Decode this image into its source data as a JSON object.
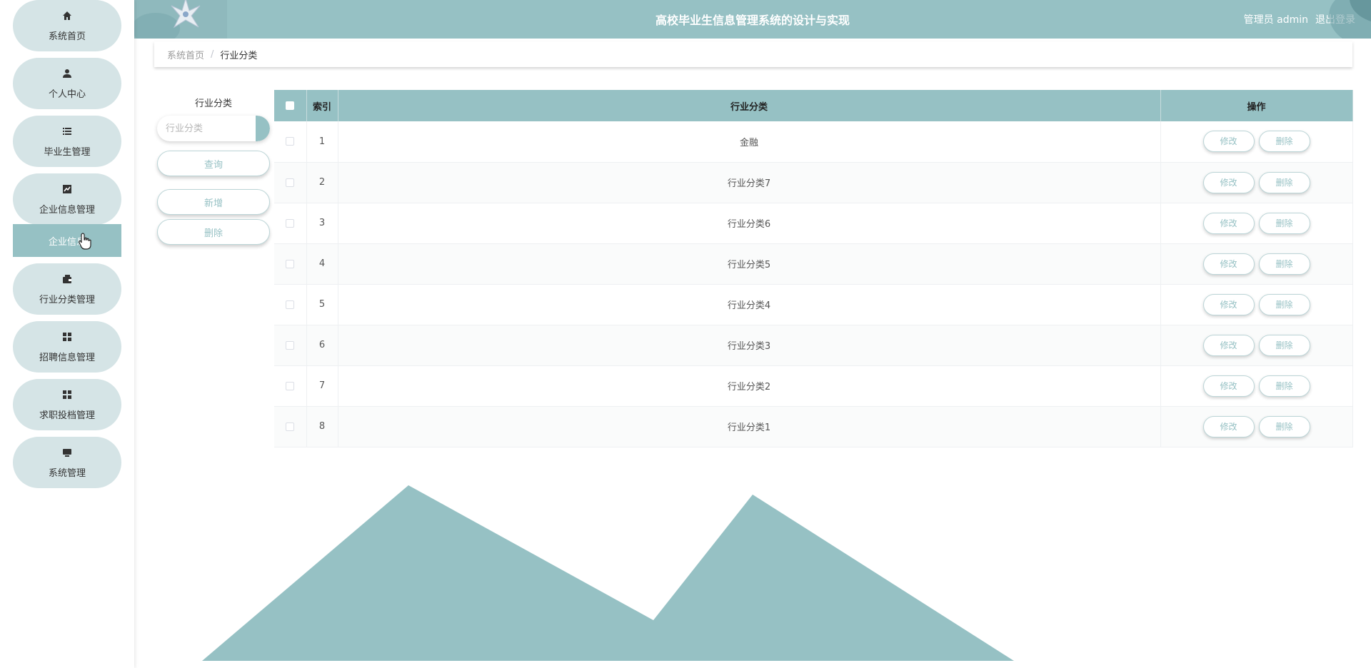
{
  "header": {
    "title": "高校毕业生信息管理系统的设计与实现",
    "user_label": "管理员 admin",
    "logout_label": "退出登录"
  },
  "sidebar": {
    "items": [
      {
        "label": "系统首页",
        "icon": "home-icon"
      },
      {
        "label": "个人中心",
        "icon": "user-icon"
      },
      {
        "label": "毕业生管理",
        "icon": "list-icon"
      },
      {
        "label": "企业信息管理",
        "icon": "chart-icon"
      },
      {
        "label": "行业分类管理",
        "icon": "wallet-icon"
      },
      {
        "label": "招聘信息管理",
        "icon": "grid-icon"
      },
      {
        "label": "求职投档管理",
        "icon": "grid-icon"
      },
      {
        "label": "系统管理",
        "icon": "monitor-icon"
      }
    ],
    "sub_item": {
      "label": "企业信息"
    }
  },
  "breadcrumb": {
    "home": "系统首页",
    "separator": "/",
    "current": "行业分类"
  },
  "search": {
    "title": "行业分类",
    "placeholder": "行业分类",
    "query_label": "查询",
    "add_label": "新增",
    "delete_label": "删除"
  },
  "table": {
    "headers": {
      "index": "索引",
      "category": "行业分类",
      "actions": "操作"
    },
    "edit_label": "修改",
    "delete_label": "删除",
    "rows": [
      {
        "index": "1",
        "category": "金融"
      },
      {
        "index": "2",
        "category": "行业分类7"
      },
      {
        "index": "3",
        "category": "行业分类6"
      },
      {
        "index": "4",
        "category": "行业分类5"
      },
      {
        "index": "5",
        "category": "行业分类4"
      },
      {
        "index": "6",
        "category": "行业分类3"
      },
      {
        "index": "7",
        "category": "行业分类2"
      },
      {
        "index": "8",
        "category": "行业分类1"
      }
    ]
  },
  "colors": {
    "accent": "#96c1c4",
    "pill": "#d5e4e6"
  }
}
